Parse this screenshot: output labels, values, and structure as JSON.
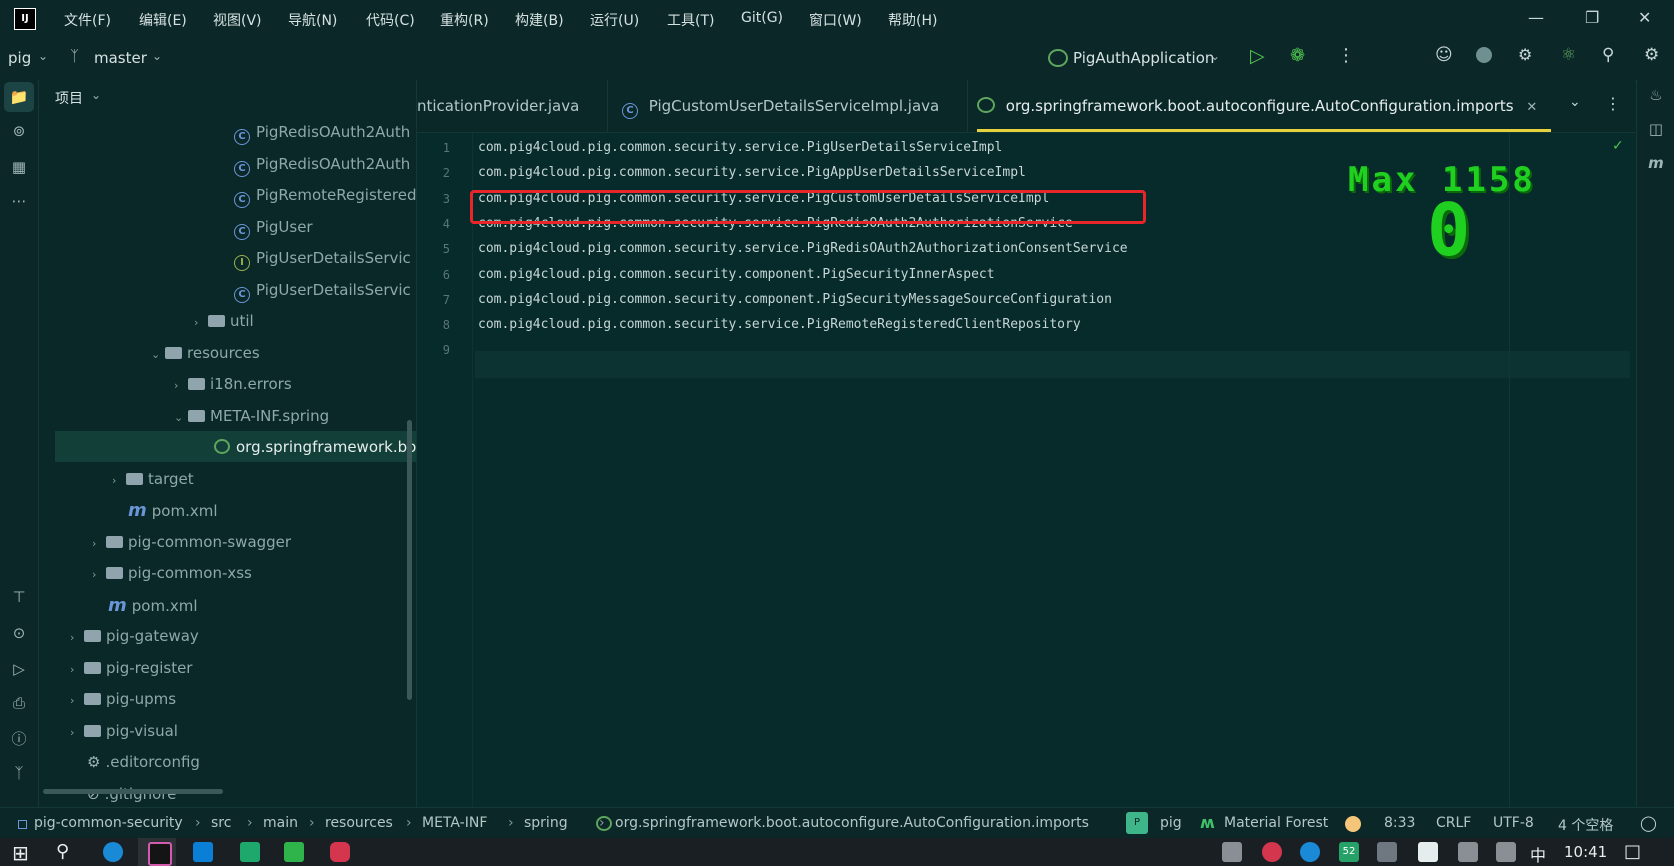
{
  "menu": {
    "items": [
      "文件(F)",
      "编辑(E)",
      "视图(V)",
      "导航(N)",
      "代码(C)",
      "重构(R)",
      "构建(B)",
      "运行(U)",
      "工具(T)",
      "Git(G)",
      "窗口(W)",
      "帮助(H)"
    ]
  },
  "toolbar": {
    "project": "pig",
    "branch": "master",
    "run_config": "PigAuthApplication"
  },
  "project_panel": {
    "title": "项目",
    "rows": [
      {
        "label": "PigRedisOAuth2Auth",
        "icon": "class-icon"
      },
      {
        "label": "PigRedisOAuth2Auth",
        "icon": "class-icon"
      },
      {
        "label": "PigRemoteRegisteredC",
        "icon": "class-icon"
      },
      {
        "label": "PigUser",
        "icon": "class-icon"
      },
      {
        "label": "PigUserDetailsServic",
        "icon": "interface-icon"
      },
      {
        "label": "PigUserDetailsServic",
        "icon": "class-icon"
      },
      {
        "label": "util",
        "icon": "folder-icon"
      },
      {
        "label": "resources",
        "icon": "folder-icon"
      },
      {
        "label": "i18n.errors",
        "icon": "folder-icon"
      },
      {
        "label": "META-INF.spring",
        "icon": "folder-icon"
      },
      {
        "label": "org.springframework.bo",
        "icon": "spring-icon"
      },
      {
        "label": "target",
        "icon": "folder-icon"
      },
      {
        "label": "pom.xml",
        "icon": "maven-icon"
      },
      {
        "label": "pig-common-swagger",
        "icon": "folder-icon"
      },
      {
        "label": "pig-common-xss",
        "icon": "folder-icon"
      },
      {
        "label": "pom.xml",
        "icon": "maven-icon"
      },
      {
        "label": "pig-gateway",
        "icon": "folder-icon"
      },
      {
        "label": "pig-register",
        "icon": "folder-icon"
      },
      {
        "label": "pig-upms",
        "icon": "folder-icon"
      },
      {
        "label": "pig-visual",
        "icon": "folder-icon"
      },
      {
        "label": ".editorconfig",
        "icon": "gear-icon"
      },
      {
        "label": ".gitignore",
        "icon": "file-icon"
      }
    ]
  },
  "tabs": [
    {
      "label": "nticationProvider.java"
    },
    {
      "label": "PigCustomUserDetailsServiceImpl.java"
    },
    {
      "label": "org.springframework.boot.autoconfigure.AutoConfiguration.imports"
    }
  ],
  "code": {
    "lines": [
      "com.pig4cloud.pig.common.security.service.PigUserDetailsServiceImpl",
      "com.pig4cloud.pig.common.security.service.PigAppUserDetailsServiceImpl",
      "com.pig4cloud.pig.common.security.service.PigCustomUserDetailsServiceImpl",
      "com.pig4cloud.pig.common.security.service.PigRedisOAuth2AuthorizationService",
      "com.pig4cloud.pig.common.security.service.PigRedisOAuth2AuthorizationConsentService",
      "com.pig4cloud.pig.common.security.component.PigSecurityInnerAspect",
      "com.pig4cloud.pig.common.security.component.PigSecurityMessageSourceConfiguration",
      "com.pig4cloud.pig.common.security.service.PigRemoteRegisteredClientRepository",
      ""
    ],
    "line_numbers": [
      "1",
      "2",
      "3",
      "4",
      "5",
      "6",
      "7",
      "8",
      "9"
    ],
    "highlighted_line": 3
  },
  "overlay": {
    "max_label": "Max 1158",
    "counter": "0"
  },
  "statusbar": {
    "breadcrumbs": [
      "pig-common-security",
      "src",
      "main",
      "resources",
      "META-INF",
      "spring",
      "org.springframework.boot.autoconfigure.AutoConfiguration.imports"
    ],
    "project_badge": "P",
    "project": "pig",
    "theme": "Material Forest",
    "position": "8:33",
    "line_sep": "CRLF",
    "encoding": "UTF-8",
    "indent": "4 个空格"
  },
  "taskbar": {
    "input_method": "中",
    "time": "10:41",
    "badge_52": "52"
  },
  "colors": {
    "accent": "#e6d23c",
    "highlight_box": "#e8262a",
    "overlay_green": "#20d020",
    "background": "#072a2a"
  }
}
